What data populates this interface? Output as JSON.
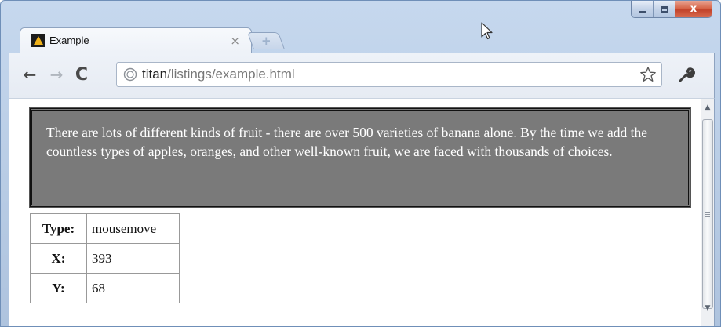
{
  "window": {
    "minimize_icon": "minimize-icon",
    "maximize_icon": "maximize-icon",
    "close_label": "x"
  },
  "tab": {
    "title": "Example",
    "close_label": "×",
    "new_tab_label": "+"
  },
  "toolbar": {
    "back_label": "←",
    "forward_label": "→",
    "reload_label": "C",
    "url_host": "titan",
    "url_path": "/listings/example.html"
  },
  "page": {
    "paragraph": "There are lots of different kinds of fruit - there are over 500 varieties of banana alone. By the time we add the countless types of apples, oranges, and other well-known fruit, we are faced with thousands of choices.",
    "event_table": [
      {
        "label": "Type:",
        "value": "mousemove"
      },
      {
        "label": "X:",
        "value": "393"
      },
      {
        "label": "Y:",
        "value": "68"
      }
    ]
  },
  "colors": {
    "box_background": "#7a7a7a",
    "favicon_accent": "#f0b21a",
    "close_button": "#c2432a"
  }
}
